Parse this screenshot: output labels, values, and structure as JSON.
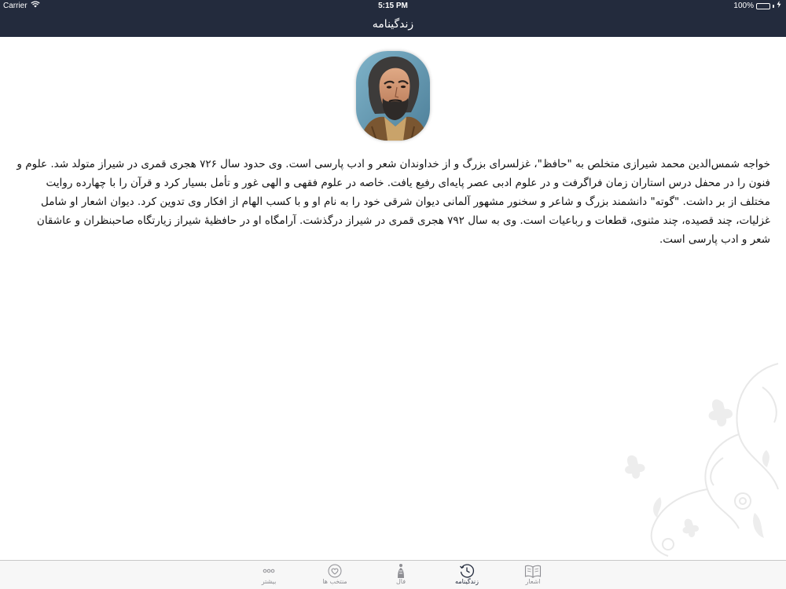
{
  "status_bar": {
    "carrier": "Carrier",
    "time": "5:15 PM",
    "battery_percent": "100%"
  },
  "nav": {
    "title": "زندگینامه"
  },
  "bio": {
    "text": "خواجه شمس‌الدین محمد شیرازی متخلص به \"حافظ\"، غزلسرای بزرگ و از خداوندان شعر و ادب پارسی است. وی حدود سال ۷۲۶ هجری قمری در شیراز متولد شد. علوم و فنون را در محفل درس استاران زمان فراگرفت و در علوم ادبی عصر پایه‌ای رفیع یافت. خاصه در علوم فقهی و الهی غور و تأمل بسیار کرد و قرآن را با چهارده روایت مختلف از بر داشت. \"گوته\" دانشمند بزرگ و شاعر و سخنور مشهور آلمانی دیوان شرقی خود را به نام او و با کسب الهام از افکار وی تدوین کرد. دیوان اشعار او شامل غزلیات، چند قصیده، چند مثنوی، قطعات و رباعیات است. وی به سال ۷۹۲ هجری قمری در شیراز درگذشت. آرامگاه او در حافظیهٔ شیراز زیارتگاه صاحبنظران و عاشقان شعر و ادب پارسی است."
  },
  "tabbar": {
    "items": [
      {
        "label": "بیشتر",
        "icon": "more-icon",
        "selected": false
      },
      {
        "label": "منتخب ها",
        "icon": "heart-icon",
        "selected": false
      },
      {
        "label": "فال",
        "icon": "fal-icon",
        "selected": false
      },
      {
        "label": "زندگینامه",
        "icon": "clock-icon",
        "selected": true
      },
      {
        "label": "اشعار",
        "icon": "book-icon",
        "selected": false
      }
    ]
  },
  "colors": {
    "nav_background": "#232b3d",
    "battery": "#4cd964",
    "tab_selected": "#232b3d",
    "tab_unselected": "#8e8e93"
  }
}
